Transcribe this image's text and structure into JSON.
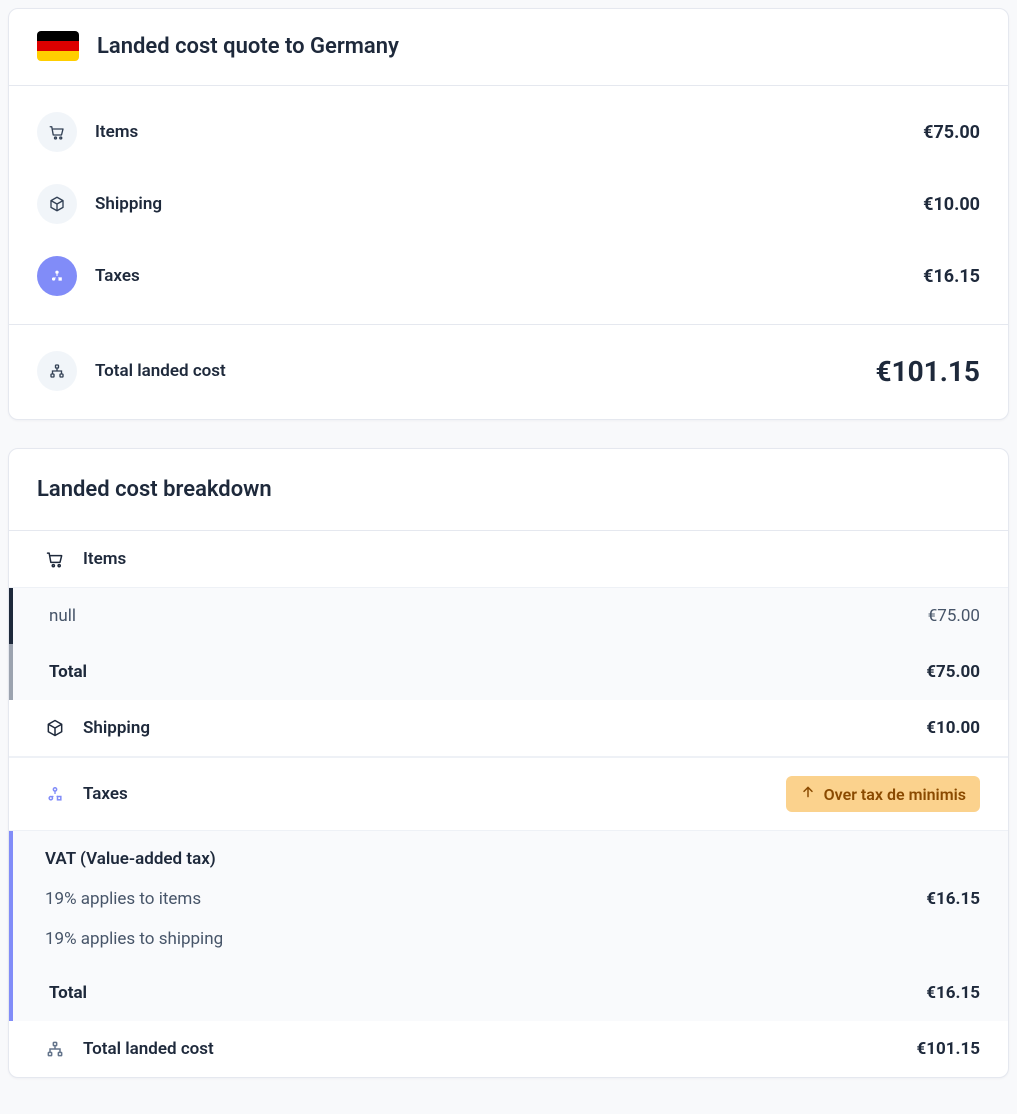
{
  "summary": {
    "title": "Landed cost quote to Germany",
    "rows": {
      "items": {
        "label": "Items",
        "value": "€75.00"
      },
      "shipping": {
        "label": "Shipping",
        "value": "€10.00"
      },
      "taxes": {
        "label": "Taxes",
        "value": "€16.15"
      }
    },
    "total": {
      "label": "Total landed cost",
      "value": "€101.15"
    }
  },
  "breakdown": {
    "title": "Landed cost breakdown",
    "items_section": {
      "label": "Items",
      "rows": [
        {
          "label": "null",
          "value": "€75.00"
        }
      ],
      "total": {
        "label": "Total",
        "value": "€75.00"
      }
    },
    "shipping_section": {
      "label": "Shipping",
      "value": "€10.00"
    },
    "taxes_section": {
      "label": "Taxes",
      "badge": "Over tax de minimis",
      "vat_label": "VAT (Value-added tax)",
      "lines": [
        {
          "label": "19% applies to items",
          "value": "€16.15"
        },
        {
          "label": "19% applies to shipping",
          "value": ""
        }
      ],
      "total": {
        "label": "Total",
        "value": "€16.15"
      }
    },
    "total": {
      "label": "Total landed cost",
      "value": "€101.15"
    }
  },
  "colors": {
    "accent": "#818cf8",
    "badge_bg": "#fbd28d",
    "badge_fg": "#8a4a00"
  }
}
